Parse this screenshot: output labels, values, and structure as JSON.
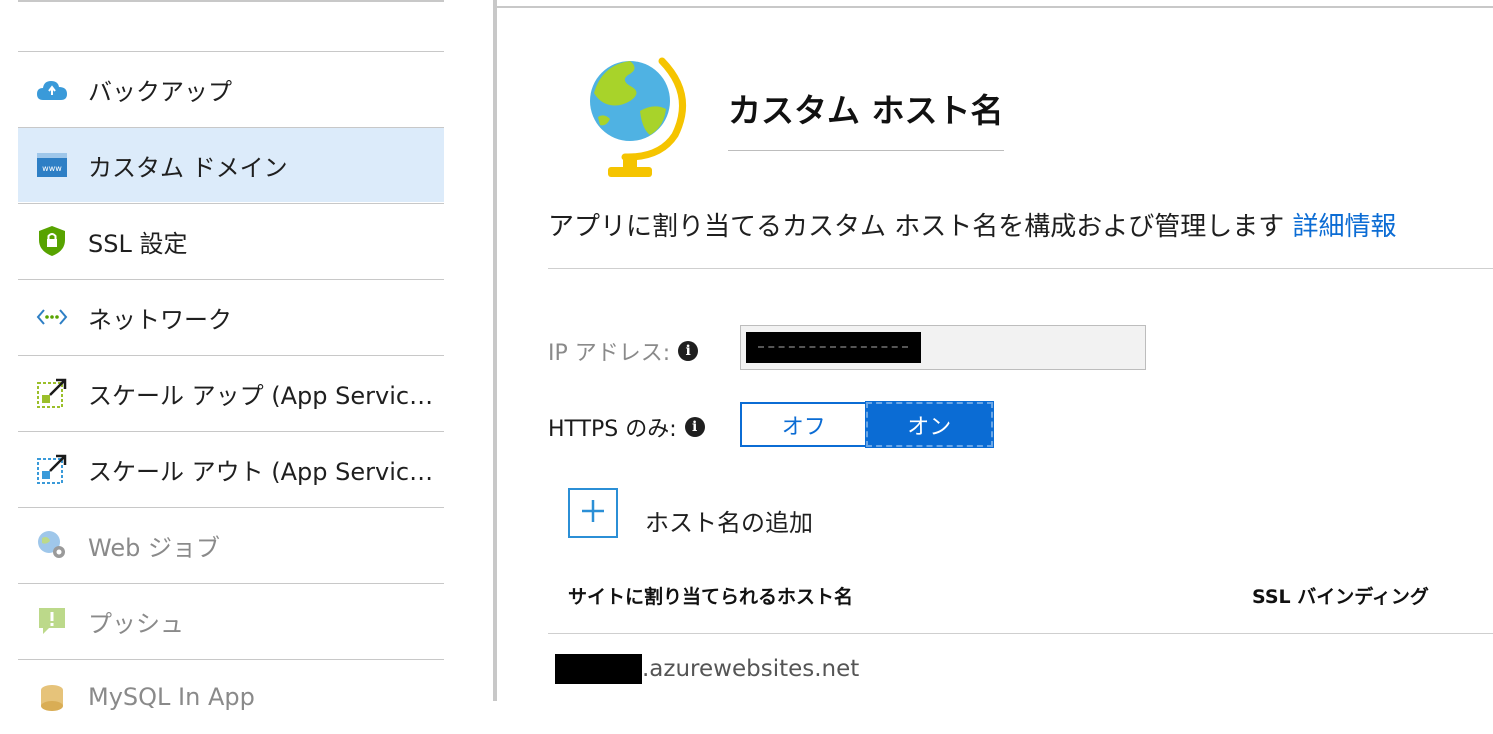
{
  "sidebar": {
    "items": [
      {
        "label": "バックアップ",
        "icon": "cloud-backup-icon",
        "state": "normal"
      },
      {
        "label": "カスタム ドメイン",
        "icon": "www-icon",
        "state": "active"
      },
      {
        "label": "SSL 設定",
        "icon": "shield-lock-icon",
        "state": "normal"
      },
      {
        "label": "ネットワーク",
        "icon": "network-icon",
        "state": "normal"
      },
      {
        "label": "スケール アップ (App Service ...",
        "icon": "scale-up-icon",
        "state": "normal"
      },
      {
        "label": "スケール アウト (App Service ...",
        "icon": "scale-out-icon",
        "state": "normal"
      },
      {
        "label": "Web ジョブ",
        "icon": "webjobs-icon",
        "state": "disabled"
      },
      {
        "label": "プッシュ",
        "icon": "push-icon",
        "state": "disabled"
      },
      {
        "label": "MySQL In App",
        "icon": "mysql-icon",
        "state": "disabled"
      }
    ]
  },
  "main": {
    "title": "カスタム ホスト名",
    "description": "アプリに割り当てるカスタム ホスト名を構成および管理します",
    "learn_more": "詳細情報",
    "ip_label": "IP アドレス:",
    "https_label": "HTTPS のみ:",
    "https_toggle": {
      "off": "オフ",
      "on": "オン",
      "selected": "on"
    },
    "add_hostname": "ホスト名の追加",
    "table": {
      "col_hostname": "サイトに割り当てられるホスト名",
      "col_ssl": "SSL バインディング",
      "rows": [
        {
          "hostname_suffix": ".azurewebsites.net"
        }
      ]
    }
  },
  "colors": {
    "accent": "#0b6cd4",
    "active_bg": "#dcebfa",
    "divider": "#c8c8c8"
  }
}
